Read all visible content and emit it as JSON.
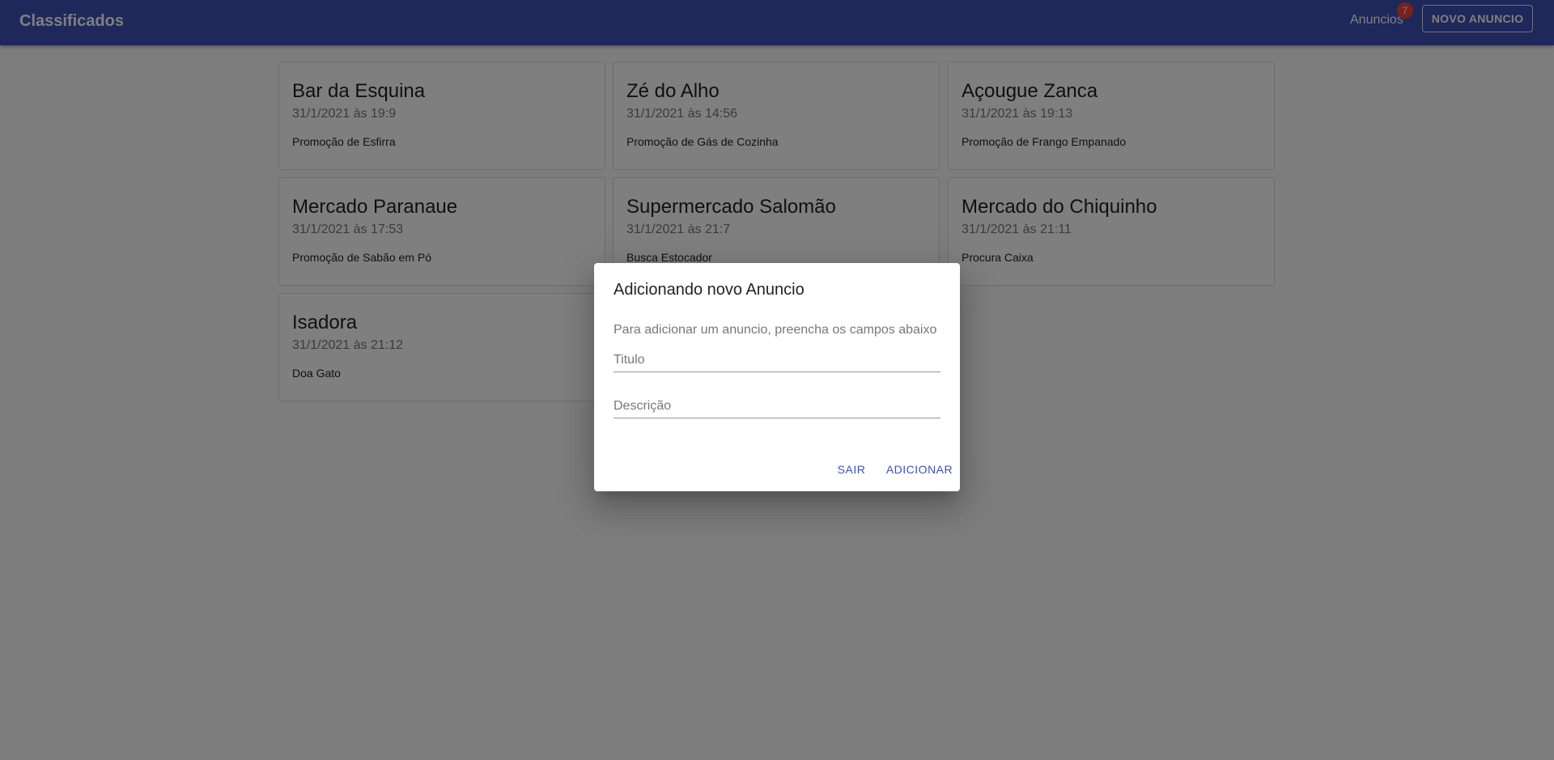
{
  "header": {
    "title": "Classificados",
    "nav_link": "Anuncios",
    "badge_count": "7",
    "new_button": "NOVO ANUNCIO"
  },
  "ads": [
    {
      "title": "Bar da Esquina",
      "date": "31/1/2021 às 19:9",
      "description": "Promoção de Esfirra"
    },
    {
      "title": "Zé do Alho",
      "date": "31/1/2021 às 14:56",
      "description": "Promoção de Gás de Cozinha"
    },
    {
      "title": "Açougue Zanca",
      "date": "31/1/2021 às 19:13",
      "description": "Promoção de Frango Empanado"
    },
    {
      "title": "Mercado Paranaue",
      "date": "31/1/2021 às 17:53",
      "description": "Promoção de Sabão em Pó"
    },
    {
      "title": "Supermercado Salomão",
      "date": "31/1/2021 às 21:7",
      "description": "Busca Estocador"
    },
    {
      "title": "Mercado do Chiquinho",
      "date": "31/1/2021 às 21:11",
      "description": "Procura Caixa"
    },
    {
      "title": "Isadora",
      "date": "31/1/2021 às 21:12",
      "description": "Doa Gato"
    }
  ],
  "dialog": {
    "title": "Adicionando novo Anuncio",
    "text": "Para adicionar um anuncio, preencha os campos abaixo",
    "title_placeholder": "Titulo",
    "title_value": "",
    "description_placeholder": "Descrição",
    "description_value": "",
    "cancel_label": "SAIR",
    "confirm_label": "ADICIONAR"
  },
  "colors": {
    "primary": "#3f51b5",
    "badge": "#f44336"
  }
}
